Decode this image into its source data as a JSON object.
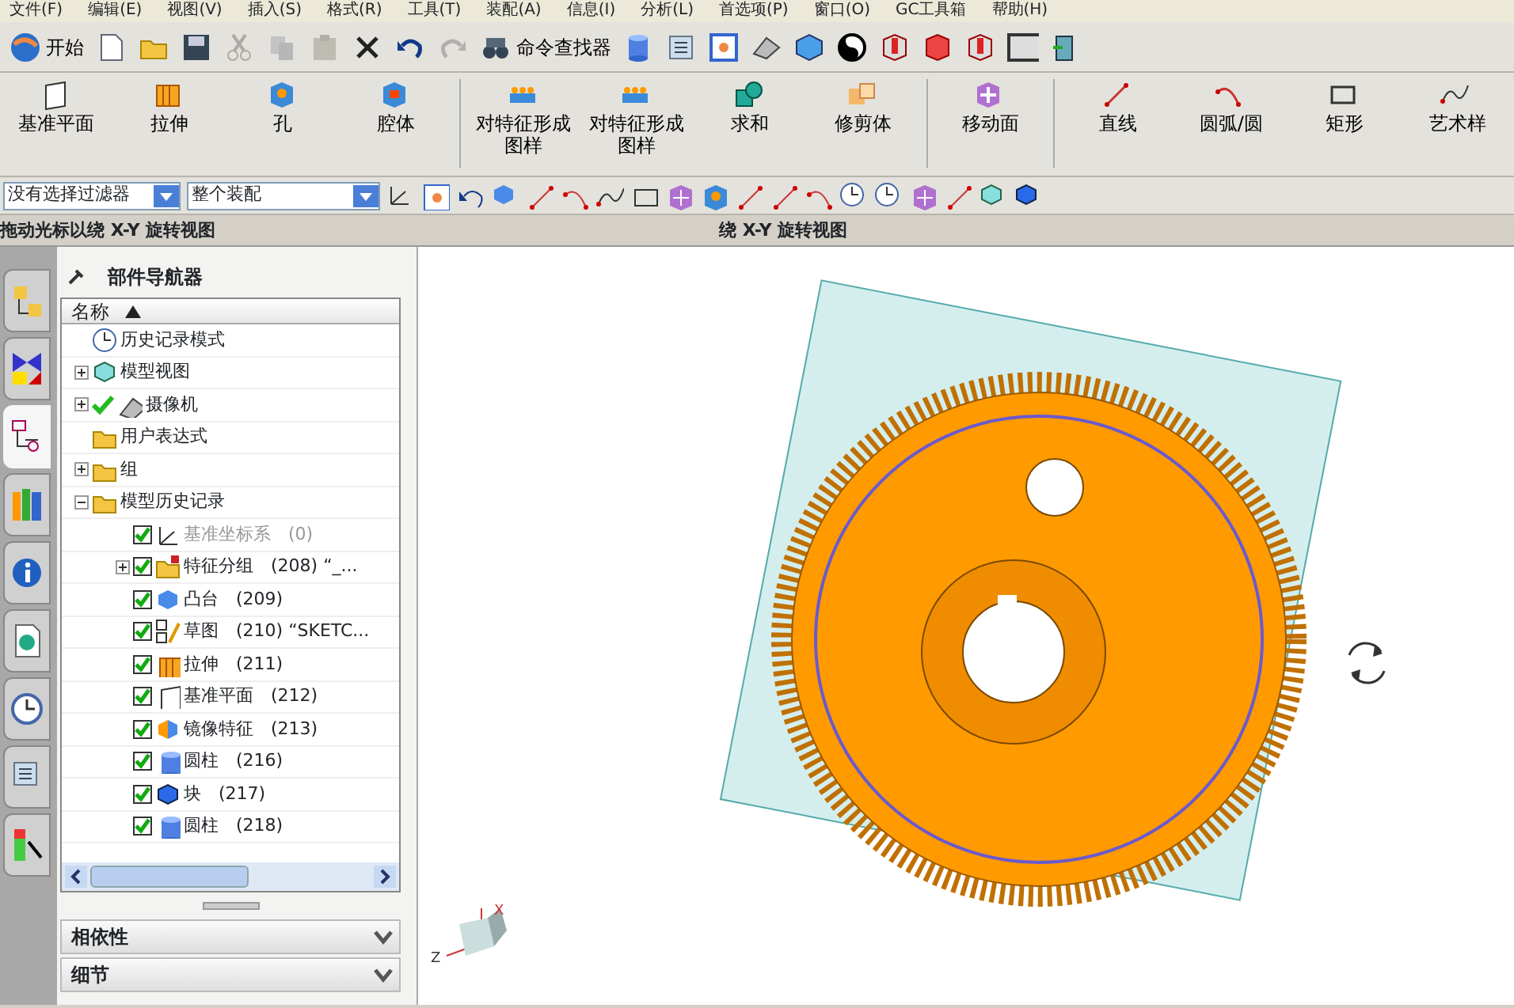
{
  "menu": [
    "文件(F)",
    "编辑(E)",
    "视图(V)",
    "插入(S)",
    "格式(R)",
    "工具(T)",
    "装配(A)",
    "信息(I)",
    "分析(L)",
    "首选项(P)",
    "窗口(O)",
    "GC工具箱",
    "帮助(H)"
  ],
  "toolbar_standard": [
    {
      "kind": "start",
      "label": "开始",
      "disabled": false
    },
    {
      "kind": "new",
      "disabled": false
    },
    {
      "kind": "open",
      "disabled": false
    },
    {
      "kind": "save",
      "disabled": false
    },
    {
      "kind": "cut",
      "disabled": true
    },
    {
      "kind": "copy",
      "disabled": true
    },
    {
      "kind": "paste",
      "disabled": true
    },
    {
      "kind": "delete",
      "disabled": false
    },
    {
      "kind": "undo",
      "disabled": false
    },
    {
      "kind": "redo",
      "disabled": true
    },
    {
      "kind": "finder",
      "label": "命令查找器",
      "disabled": false
    },
    {
      "kind": "cylinder",
      "disabled": false
    },
    {
      "kind": "list",
      "disabled": false
    },
    {
      "kind": "fit",
      "disabled": false
    },
    {
      "kind": "camera",
      "disabled": false
    },
    {
      "kind": "cube",
      "disabled": false
    },
    {
      "kind": "shade",
      "disabled": false
    },
    {
      "kind": "section",
      "disabled": false
    },
    {
      "kind": "wirebox",
      "disabled": false
    },
    {
      "kind": "section",
      "disabled": false
    },
    {
      "kind": "swatch",
      "disabled": false
    },
    {
      "kind": "door",
      "disabled": false
    }
  ],
  "toolbar_features": [
    {
      "kind": "plane",
      "label": "基准平面"
    },
    {
      "kind": "extrude",
      "label": "拉伸"
    },
    {
      "kind": "hole",
      "label": "孔"
    },
    {
      "kind": "pocket",
      "label": "腔体"
    },
    {
      "kind": "pattern",
      "label": "对特征形成图样"
    },
    {
      "kind": "pattern",
      "label": "对特征形成图样"
    },
    {
      "kind": "unite",
      "label": "求和"
    },
    {
      "kind": "trim",
      "label": "修剪体"
    },
    {
      "kind": "moveface",
      "label": "移动面"
    },
    {
      "kind": "line",
      "label": "直线"
    },
    {
      "kind": "arc",
      "label": "圆弧/圆"
    },
    {
      "kind": "rect",
      "label": "矩形"
    },
    {
      "kind": "spline",
      "label": "艺术样"
    }
  ],
  "selection_bar": {
    "filter": "没有选择过滤器",
    "scope": "整个装配"
  },
  "status_bar": {
    "prompt": "拖动光标以绕 X-Y 旋转视图",
    "status": "绕 X-Y 旋转视图"
  },
  "resource_tabs": [
    {
      "kind": "assembly",
      "selected": false
    },
    {
      "kind": "constraint",
      "selected": false
    },
    {
      "kind": "part",
      "selected": true
    },
    {
      "kind": "library",
      "selected": false
    },
    {
      "kind": "info",
      "selected": false
    },
    {
      "kind": "web",
      "selected": false
    },
    {
      "kind": "history",
      "selected": false
    },
    {
      "kind": "list",
      "selected": false
    },
    {
      "kind": "palette",
      "selected": false
    }
  ],
  "navigator": {
    "title": "部件导航器",
    "column": "名称",
    "sort_ascending": true,
    "tree": [
      {
        "kind": "clock",
        "label": "历史记录模式"
      },
      {
        "kind": "view",
        "label": "模型视图",
        "expanded": false
      },
      {
        "kind": "camera",
        "label": "摄像机",
        "expanded": false,
        "checked": true
      },
      {
        "kind": "expr",
        "label": "用户表达式"
      },
      {
        "kind": "folder",
        "label": "组",
        "expanded": false
      },
      {
        "kind": "folder",
        "label": "模型历史记录",
        "expanded": true,
        "children": [
          {
            "kind": "csys",
            "label": "基准坐标系",
            "id": "(0)",
            "checked": true,
            "disabled": true
          },
          {
            "kind": "group",
            "label": "特征分组",
            "id": "(208)",
            "suffix": "“_...",
            "checked": true,
            "expanded": false
          },
          {
            "kind": "boss",
            "label": "凸台",
            "id": "(209)",
            "checked": true
          },
          {
            "kind": "sketch",
            "label": "草图",
            "id": "(210)",
            "suffix": "“SKETC...",
            "checked": true
          },
          {
            "kind": "extrude",
            "label": "拉伸",
            "id": "(211)",
            "checked": true
          },
          {
            "kind": "plane",
            "label": "基准平面",
            "id": "(212)",
            "checked": true
          },
          {
            "kind": "mirror",
            "label": "镜像特征",
            "id": "(213)",
            "checked": true
          },
          {
            "kind": "cylinder",
            "label": "圆柱",
            "id": "(216)",
            "checked": true
          },
          {
            "kind": "block",
            "label": "块",
            "id": "(217)",
            "checked": true
          },
          {
            "kind": "cylinder",
            "label": "圆柱",
            "id": "(218)",
            "checked": true
          }
        ]
      }
    ]
  },
  "triad": {
    "x_label": "X",
    "z_label": "Z"
  },
  "sections": [
    {
      "label": "相依性",
      "expanded": false
    },
    {
      "label": "细节",
      "expanded": false
    }
  ]
}
